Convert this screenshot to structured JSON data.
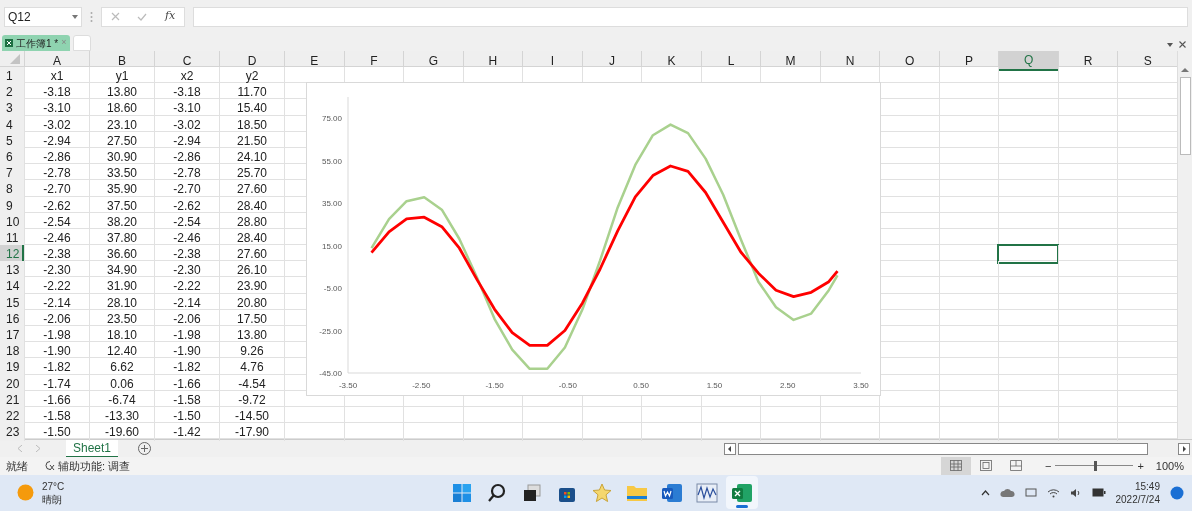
{
  "formula_bar": {
    "name_box": "Q12",
    "fx": "fx"
  },
  "workbook_tabs": [
    {
      "label": "工作簿1 *",
      "selected": true,
      "close": "×"
    }
  ],
  "columns": [
    {
      "label": "A",
      "selected": false
    },
    {
      "label": "B",
      "selected": false
    },
    {
      "label": "C",
      "selected": false
    },
    {
      "label": "D",
      "selected": false
    },
    {
      "label": "E",
      "selected": false
    },
    {
      "label": "F",
      "selected": false
    },
    {
      "label": "G",
      "selected": false
    },
    {
      "label": "H",
      "selected": false
    },
    {
      "label": "I",
      "selected": false
    },
    {
      "label": "J",
      "selected": false
    },
    {
      "label": "K",
      "selected": false
    },
    {
      "label": "L",
      "selected": false
    },
    {
      "label": "M",
      "selected": false
    },
    {
      "label": "N",
      "selected": false
    },
    {
      "label": "O",
      "selected": false
    },
    {
      "label": "P",
      "selected": false
    },
    {
      "label": "Q",
      "selected": true
    },
    {
      "label": "R",
      "selected": false
    },
    {
      "label": "S",
      "selected": false
    }
  ],
  "rows": [
    {
      "number": "1",
      "selected": false,
      "cells": [
        "x1",
        "y1",
        "x2",
        "y2"
      ]
    },
    {
      "number": "2",
      "selected": false,
      "cells": [
        "-3.18",
        "13.80",
        "-3.18",
        "11.70"
      ]
    },
    {
      "number": "3",
      "selected": false,
      "cells": [
        "-3.10",
        "18.60",
        "-3.10",
        "15.40"
      ]
    },
    {
      "number": "4",
      "selected": false,
      "cells": [
        "-3.02",
        "23.10",
        "-3.02",
        "18.50"
      ]
    },
    {
      "number": "5",
      "selected": false,
      "cells": [
        "-2.94",
        "27.50",
        "-2.94",
        "21.50"
      ]
    },
    {
      "number": "6",
      "selected": false,
      "cells": [
        "-2.86",
        "30.90",
        "-2.86",
        "24.10"
      ]
    },
    {
      "number": "7",
      "selected": false,
      "cells": [
        "-2.78",
        "33.50",
        "-2.78",
        "25.70"
      ]
    },
    {
      "number": "8",
      "selected": false,
      "cells": [
        "-2.70",
        "35.90",
        "-2.70",
        "27.60"
      ]
    },
    {
      "number": "9",
      "selected": false,
      "cells": [
        "-2.62",
        "37.50",
        "-2.62",
        "28.40"
      ]
    },
    {
      "number": "10",
      "selected": false,
      "cells": [
        "-2.54",
        "38.20",
        "-2.54",
        "28.80"
      ]
    },
    {
      "number": "11",
      "selected": false,
      "cells": [
        "-2.46",
        "37.80",
        "-2.46",
        "28.40"
      ]
    },
    {
      "number": "12",
      "selected": true,
      "cells": [
        "-2.38",
        "36.60",
        "-2.38",
        "27.60"
      ]
    },
    {
      "number": "13",
      "selected": false,
      "cells": [
        "-2.30",
        "34.90",
        "-2.30",
        "26.10"
      ]
    },
    {
      "number": "14",
      "selected": false,
      "cells": [
        "-2.22",
        "31.90",
        "-2.22",
        "23.90"
      ]
    },
    {
      "number": "15",
      "selected": false,
      "cells": [
        "-2.14",
        "28.10",
        "-2.14",
        "20.80"
      ]
    },
    {
      "number": "16",
      "selected": false,
      "cells": [
        "-2.06",
        "23.50",
        "-2.06",
        "17.50"
      ]
    },
    {
      "number": "17",
      "selected": false,
      "cells": [
        "-1.98",
        "18.10",
        "-1.98",
        "13.80"
      ]
    },
    {
      "number": "18",
      "selected": false,
      "cells": [
        "-1.90",
        "12.40",
        "-1.90",
        "9.26"
      ]
    },
    {
      "number": "19",
      "selected": false,
      "cells": [
        "-1.82",
        "6.62",
        "-1.82",
        "4.76"
      ]
    },
    {
      "number": "20",
      "selected": false,
      "cells": [
        "-1.74",
        "0.06",
        "-1.66",
        "-4.54"
      ]
    },
    {
      "number": "21",
      "selected": false,
      "cells": [
        "-1.66",
        "-6.74",
        "-1.58",
        "-9.72"
      ]
    },
    {
      "number": "22",
      "selected": false,
      "cells": [
        "-1.58",
        "-13.30",
        "-1.50",
        "-14.50"
      ]
    },
    {
      "number": "23",
      "selected": false,
      "cells": [
        "-1.50",
        "-19.60",
        "-1.42",
        "-17.90"
      ]
    }
  ],
  "chart": {
    "chart_data": {
      "type": "line",
      "x": [
        -3.18,
        -2.94,
        -2.7,
        -2.46,
        -2.22,
        -1.98,
        -1.74,
        -1.5,
        -1.26,
        -1.02,
        -0.78,
        -0.54,
        -0.3,
        -0.06,
        0.18,
        0.42,
        0.66,
        0.9,
        1.14,
        1.38,
        1.62,
        1.86,
        2.1,
        2.34,
        2.58,
        2.82,
        3.06,
        3.18
      ],
      "series": [
        {
          "color": "#a9d18e",
          "values": [
            13.8,
            27.5,
            35.9,
            37.8,
            31.9,
            18.1,
            0,
            -19.6,
            -34,
            -43,
            -43,
            -33,
            -15,
            8,
            33,
            53,
            67,
            72,
            68,
            56,
            39,
            18,
            -2,
            -14,
            -20,
            -17,
            -6,
            1
          ]
        },
        {
          "color": "#ff0000",
          "values": [
            11.7,
            21.5,
            27.6,
            28.4,
            23.9,
            13.8,
            -1,
            -15,
            -26,
            -32,
            -32,
            -25,
            -12,
            4,
            22,
            38,
            48,
            52.5,
            50,
            40,
            26,
            12,
            2,
            -6,
            -9,
            -7,
            -2,
            3
          ]
        }
      ],
      "xlim": [
        -3.5,
        3.5
      ],
      "ylim": [
        -45,
        85
      ],
      "xticks": [
        {
          "value": -3.5,
          "label": "-3.50"
        },
        {
          "value": -2.5,
          "label": "-2.50"
        },
        {
          "value": -1.5,
          "label": "-1.50"
        },
        {
          "value": -0.5,
          "label": "-0.50"
        },
        {
          "value": 0.5,
          "label": "0.50"
        },
        {
          "value": 1.5,
          "label": "1.50"
        },
        {
          "value": 2.5,
          "label": "2.50"
        },
        {
          "value": 3.5,
          "label": "3.50"
        }
      ],
      "yticks": [
        {
          "value": -45,
          "label": "-45.00"
        },
        {
          "value": -25,
          "label": "-25.00"
        },
        {
          "value": -5,
          "label": "-5.00"
        },
        {
          "value": 15,
          "label": "15.00"
        },
        {
          "value": 35,
          "label": "35.00"
        },
        {
          "value": 55,
          "label": "55.00"
        },
        {
          "value": 75,
          "label": "75.00"
        }
      ]
    }
  },
  "sheet_tabs": [
    {
      "label": "Sheet1",
      "selected": true
    }
  ],
  "status_bar": {
    "ready": "就绪",
    "accessibility": "辅助功能: 调查",
    "views": [
      {
        "kind": "normal",
        "selected": true
      },
      {
        "kind": "page-layout",
        "selected": false
      },
      {
        "kind": "page-break",
        "selected": false
      }
    ],
    "zoom_minus": "−",
    "zoom_plus": "+",
    "zoom": {
      "level": 0.52
    },
    "zoom_text": "100%"
  },
  "taskbar": {
    "weather": {
      "temperature": "27°C",
      "condition": "晴朗"
    },
    "apps": [
      {
        "kind": "start",
        "active": false
      },
      {
        "kind": "search",
        "active": false
      },
      {
        "kind": "taskview",
        "active": false
      },
      {
        "kind": "store",
        "active": false
      },
      {
        "kind": "star",
        "active": false
      },
      {
        "kind": "folder",
        "active": false
      },
      {
        "kind": "word",
        "active": false
      },
      {
        "kind": "chart",
        "active": false
      },
      {
        "kind": "excel",
        "active": true
      }
    ],
    "time": "15:49",
    "date": "2022/7/24"
  }
}
